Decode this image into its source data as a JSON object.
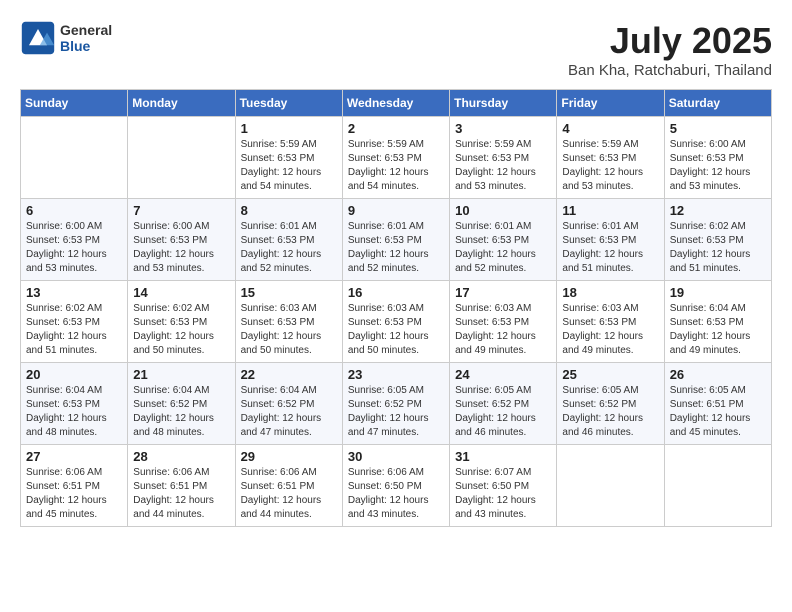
{
  "header": {
    "logo_general": "General",
    "logo_blue": "Blue",
    "month": "July 2025",
    "location": "Ban Kha, Ratchaburi, Thailand"
  },
  "weekdays": [
    "Sunday",
    "Monday",
    "Tuesday",
    "Wednesday",
    "Thursday",
    "Friday",
    "Saturday"
  ],
  "weeks": [
    [
      {
        "day": "",
        "info": ""
      },
      {
        "day": "",
        "info": ""
      },
      {
        "day": "1",
        "info": "Sunrise: 5:59 AM\nSunset: 6:53 PM\nDaylight: 12 hours\nand 54 minutes."
      },
      {
        "day": "2",
        "info": "Sunrise: 5:59 AM\nSunset: 6:53 PM\nDaylight: 12 hours\nand 54 minutes."
      },
      {
        "day": "3",
        "info": "Sunrise: 5:59 AM\nSunset: 6:53 PM\nDaylight: 12 hours\nand 53 minutes."
      },
      {
        "day": "4",
        "info": "Sunrise: 5:59 AM\nSunset: 6:53 PM\nDaylight: 12 hours\nand 53 minutes."
      },
      {
        "day": "5",
        "info": "Sunrise: 6:00 AM\nSunset: 6:53 PM\nDaylight: 12 hours\nand 53 minutes."
      }
    ],
    [
      {
        "day": "6",
        "info": "Sunrise: 6:00 AM\nSunset: 6:53 PM\nDaylight: 12 hours\nand 53 minutes."
      },
      {
        "day": "7",
        "info": "Sunrise: 6:00 AM\nSunset: 6:53 PM\nDaylight: 12 hours\nand 53 minutes."
      },
      {
        "day": "8",
        "info": "Sunrise: 6:01 AM\nSunset: 6:53 PM\nDaylight: 12 hours\nand 52 minutes."
      },
      {
        "day": "9",
        "info": "Sunrise: 6:01 AM\nSunset: 6:53 PM\nDaylight: 12 hours\nand 52 minutes."
      },
      {
        "day": "10",
        "info": "Sunrise: 6:01 AM\nSunset: 6:53 PM\nDaylight: 12 hours\nand 52 minutes."
      },
      {
        "day": "11",
        "info": "Sunrise: 6:01 AM\nSunset: 6:53 PM\nDaylight: 12 hours\nand 51 minutes."
      },
      {
        "day": "12",
        "info": "Sunrise: 6:02 AM\nSunset: 6:53 PM\nDaylight: 12 hours\nand 51 minutes."
      }
    ],
    [
      {
        "day": "13",
        "info": "Sunrise: 6:02 AM\nSunset: 6:53 PM\nDaylight: 12 hours\nand 51 minutes."
      },
      {
        "day": "14",
        "info": "Sunrise: 6:02 AM\nSunset: 6:53 PM\nDaylight: 12 hours\nand 50 minutes."
      },
      {
        "day": "15",
        "info": "Sunrise: 6:03 AM\nSunset: 6:53 PM\nDaylight: 12 hours\nand 50 minutes."
      },
      {
        "day": "16",
        "info": "Sunrise: 6:03 AM\nSunset: 6:53 PM\nDaylight: 12 hours\nand 50 minutes."
      },
      {
        "day": "17",
        "info": "Sunrise: 6:03 AM\nSunset: 6:53 PM\nDaylight: 12 hours\nand 49 minutes."
      },
      {
        "day": "18",
        "info": "Sunrise: 6:03 AM\nSunset: 6:53 PM\nDaylight: 12 hours\nand 49 minutes."
      },
      {
        "day": "19",
        "info": "Sunrise: 6:04 AM\nSunset: 6:53 PM\nDaylight: 12 hours\nand 49 minutes."
      }
    ],
    [
      {
        "day": "20",
        "info": "Sunrise: 6:04 AM\nSunset: 6:53 PM\nDaylight: 12 hours\nand 48 minutes."
      },
      {
        "day": "21",
        "info": "Sunrise: 6:04 AM\nSunset: 6:52 PM\nDaylight: 12 hours\nand 48 minutes."
      },
      {
        "day": "22",
        "info": "Sunrise: 6:04 AM\nSunset: 6:52 PM\nDaylight: 12 hours\nand 47 minutes."
      },
      {
        "day": "23",
        "info": "Sunrise: 6:05 AM\nSunset: 6:52 PM\nDaylight: 12 hours\nand 47 minutes."
      },
      {
        "day": "24",
        "info": "Sunrise: 6:05 AM\nSunset: 6:52 PM\nDaylight: 12 hours\nand 46 minutes."
      },
      {
        "day": "25",
        "info": "Sunrise: 6:05 AM\nSunset: 6:52 PM\nDaylight: 12 hours\nand 46 minutes."
      },
      {
        "day": "26",
        "info": "Sunrise: 6:05 AM\nSunset: 6:51 PM\nDaylight: 12 hours\nand 45 minutes."
      }
    ],
    [
      {
        "day": "27",
        "info": "Sunrise: 6:06 AM\nSunset: 6:51 PM\nDaylight: 12 hours\nand 45 minutes."
      },
      {
        "day": "28",
        "info": "Sunrise: 6:06 AM\nSunset: 6:51 PM\nDaylight: 12 hours\nand 44 minutes."
      },
      {
        "day": "29",
        "info": "Sunrise: 6:06 AM\nSunset: 6:51 PM\nDaylight: 12 hours\nand 44 minutes."
      },
      {
        "day": "30",
        "info": "Sunrise: 6:06 AM\nSunset: 6:50 PM\nDaylight: 12 hours\nand 43 minutes."
      },
      {
        "day": "31",
        "info": "Sunrise: 6:07 AM\nSunset: 6:50 PM\nDaylight: 12 hours\nand 43 minutes."
      },
      {
        "day": "",
        "info": ""
      },
      {
        "day": "",
        "info": ""
      }
    ]
  ]
}
